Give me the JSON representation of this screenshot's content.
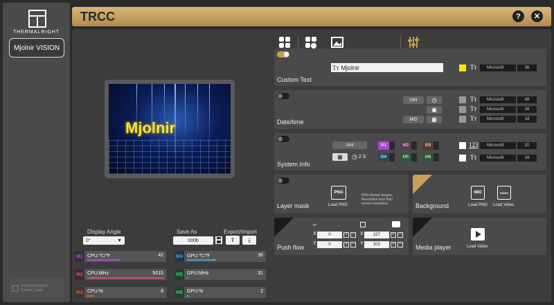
{
  "sidebar": {
    "brand": "THERMALRIGHT",
    "device_button": "Mjolnir VISION",
    "footer_logo_line1": "THERMALRIGHT",
    "footer_logo_line2": "Control Center"
  },
  "header": {
    "title": "TRCC",
    "help_label": "?",
    "close_label": "✕"
  },
  "preview": {
    "text": "Mjolnir"
  },
  "controls": {
    "display_angle_label": "Display Angle",
    "display_angle_value": "0°",
    "save_as_label": "Save As",
    "save_as_value": "000b",
    "export_import_label": "Export/Import"
  },
  "sensors": {
    "left": [
      {
        "code": "M1",
        "name": "CPU:℃/℉",
        "value": "42",
        "color": "#b04ad6"
      },
      {
        "code": "M2",
        "name": "CPU:MHz",
        "value": "5015",
        "color": "#d64a8a"
      },
      {
        "code": "M3",
        "name": "CPU:%",
        "value": "8",
        "color": "#e0553a"
      }
    ],
    "right": [
      {
        "code": "M4",
        "name": "GPU:℃/℉",
        "value": "36",
        "color": "#3aa7d6"
      },
      {
        "code": "M5",
        "name": "GPU:MHz",
        "value": "31",
        "color": "#2ecc71"
      },
      {
        "code": "M6",
        "name": "GPU:%",
        "value": "2",
        "color": "#2ecc71"
      }
    ]
  },
  "custom_text": {
    "title": "Custom Text",
    "value": "Mjolnir",
    "font": "Microsoft",
    "size": "36",
    "color": "#ffe600"
  },
  "datetime": {
    "title": "Date/time",
    "btn_24h": "24H",
    "btn_md": "M/D",
    "rows": [
      {
        "font": "Microsoft",
        "size": "48"
      },
      {
        "font": "Microsoft",
        "size": "16"
      },
      {
        "font": "Microsoft",
        "size": "18"
      }
    ]
  },
  "system_info": {
    "title": "System Info",
    "unit_label": "Unit",
    "interval_value": "2",
    "interval_unit": "S",
    "m_labels": [
      "M1",
      "M2",
      "M3",
      "M4",
      "M5",
      "M6"
    ],
    "rows": [
      {
        "font": "Microsoft",
        "size": "20",
        "prefix": "123"
      },
      {
        "font": "Microsoft",
        "size": "16",
        "prefix": ""
      }
    ]
  },
  "layer_mask": {
    "title": "Layer mask",
    "load_label": "Load PNG",
    "note": "PNG format images. Resolution less than screen resolution"
  },
  "background": {
    "title": "Background",
    "load_png": "Load PNG",
    "load_video": "Load Video"
  },
  "push_flow": {
    "title": "Push flow",
    "x1": "0",
    "y1": "0",
    "x2": "227",
    "y2": "302",
    "x_label": "X",
    "y_label": "Y"
  },
  "media_player": {
    "title": "Media player",
    "load_video": "Load Video"
  },
  "icon_labels": {
    "png": "PNG",
    "img": "IMG",
    "video": "VIDEO"
  },
  "colors": {
    "accent": "#c99f4c",
    "header_gold": "#d9b877"
  }
}
